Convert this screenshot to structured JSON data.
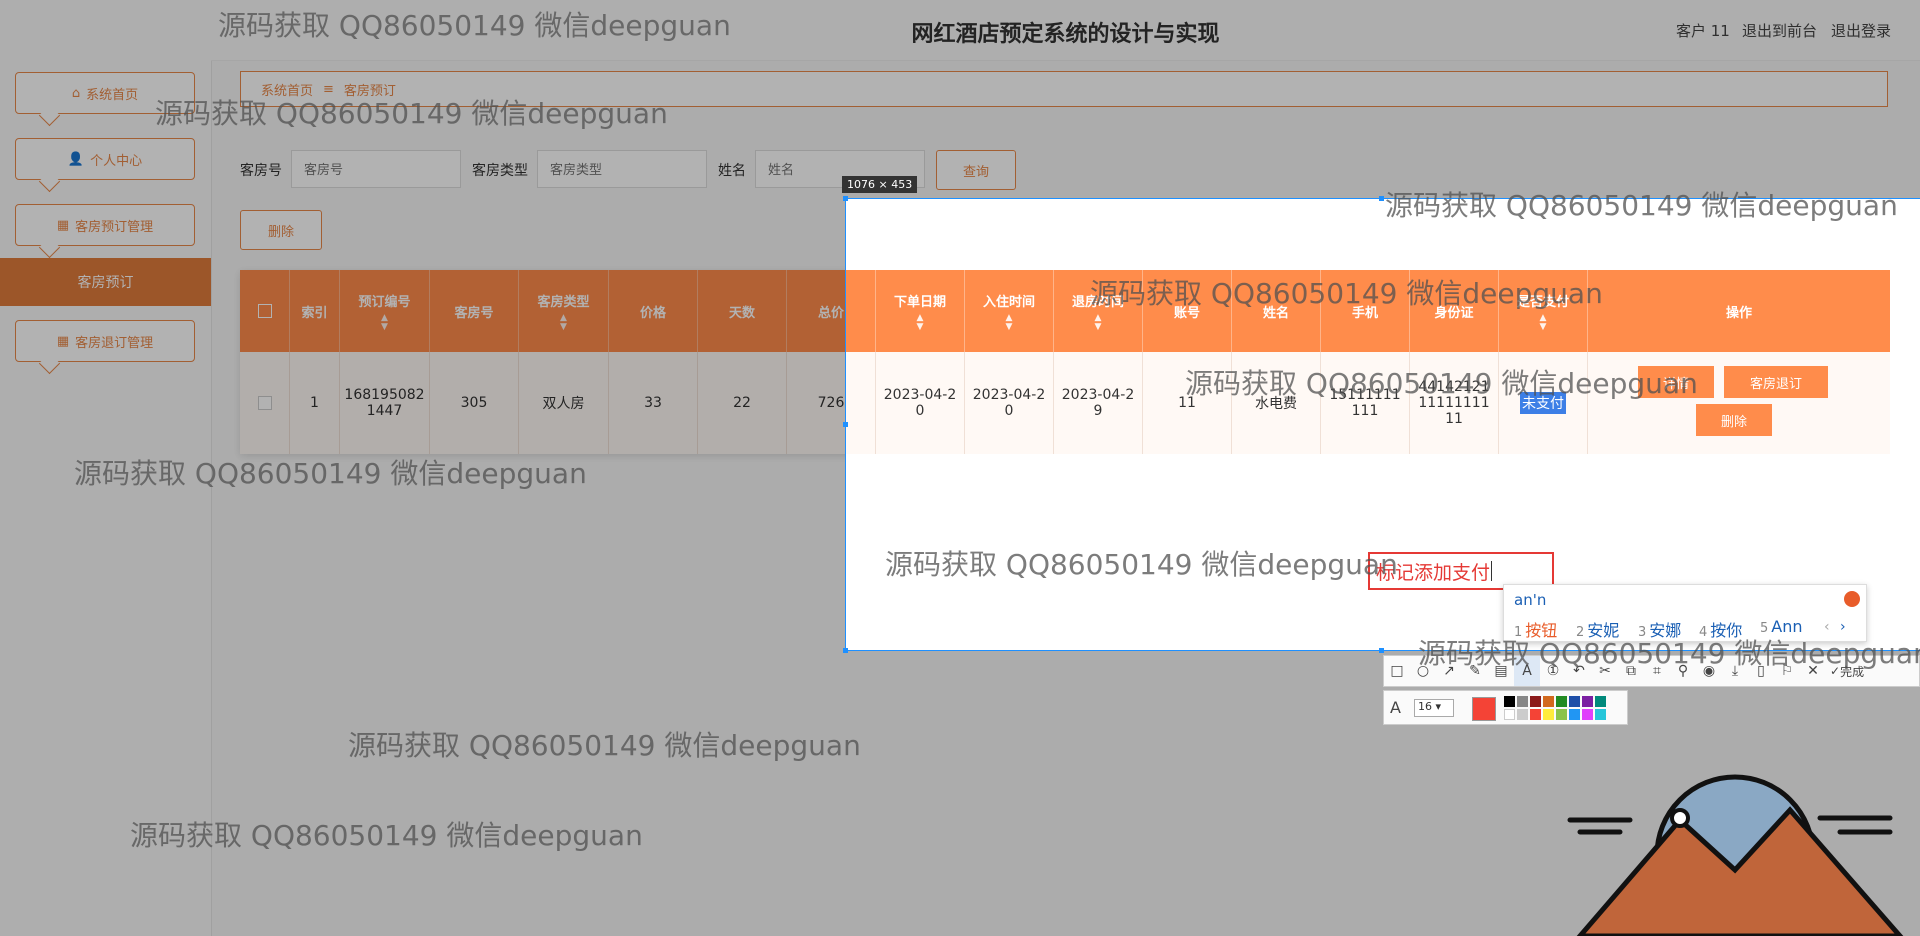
{
  "header": {
    "title": "网红酒店预定系统的设计与实现",
    "user": "客户 11",
    "back_front": "退出到前台",
    "logout": "退出登录"
  },
  "sidebar": {
    "items": [
      {
        "label": "系统首页",
        "icon": "home-icon"
      },
      {
        "label": "个人中心",
        "icon": "user-icon"
      },
      {
        "label": "客房预订管理",
        "icon": "grid-icon"
      },
      {
        "label": "客房预订",
        "active": true
      },
      {
        "label": "客房退订管理",
        "icon": "grid-icon"
      }
    ]
  },
  "breadcrumb": {
    "home": "系统首页",
    "separator": "≡",
    "current": "客房预订"
  },
  "search": {
    "room_no_label": "客房号",
    "room_no_placeholder": "客房号",
    "room_type_label": "客房类型",
    "room_type_placeholder": "客房类型",
    "name_label": "姓名",
    "name_placeholder": "姓名",
    "query_button": "查询"
  },
  "actions": {
    "delete_button": "删除"
  },
  "table": {
    "headers": [
      "索引",
      "预订编号",
      "客房号",
      "客房类型",
      "价格",
      "天数",
      "总价",
      "下单日期",
      "入住时间",
      "退房时间",
      "账号",
      "姓名",
      "手机",
      "身份证",
      "是否支付",
      "操作"
    ],
    "row": {
      "index": "1",
      "order_no": "1681950821447",
      "room_no": "305",
      "room_type": "双人房",
      "price": "33",
      "days": "22",
      "total": "726",
      "order_date": "2023-04-20",
      "checkin": "2023-04-20",
      "checkout": "2023-04-29",
      "account": "11",
      "name": "水电费",
      "phone": "15111111111",
      "id_card": "441421211111111111",
      "paid": "未支付",
      "btn_detail": "详情",
      "btn_refund": "客房退订",
      "btn_delete": "删除"
    }
  },
  "screenshot_tool": {
    "size": "1076 × 453",
    "annotation_text": "标记添加支付",
    "font_size": "16",
    "done": "完成",
    "ime": {
      "input": "an'n",
      "candidates": [
        {
          "n": "1",
          "text": "按钮"
        },
        {
          "n": "2",
          "text": "安妮"
        },
        {
          "n": "3",
          "text": "安娜"
        },
        {
          "n": "4",
          "text": "按你"
        },
        {
          "n": "5",
          "text": "Ann"
        }
      ]
    }
  },
  "watermark": "源码获取 QQ86050149 微信deepguan",
  "colors": {
    "accent": "#ff8c4b",
    "accent_dark": "#e07b3c",
    "selection": "#1e90ff",
    "annotation": "#e53935"
  }
}
